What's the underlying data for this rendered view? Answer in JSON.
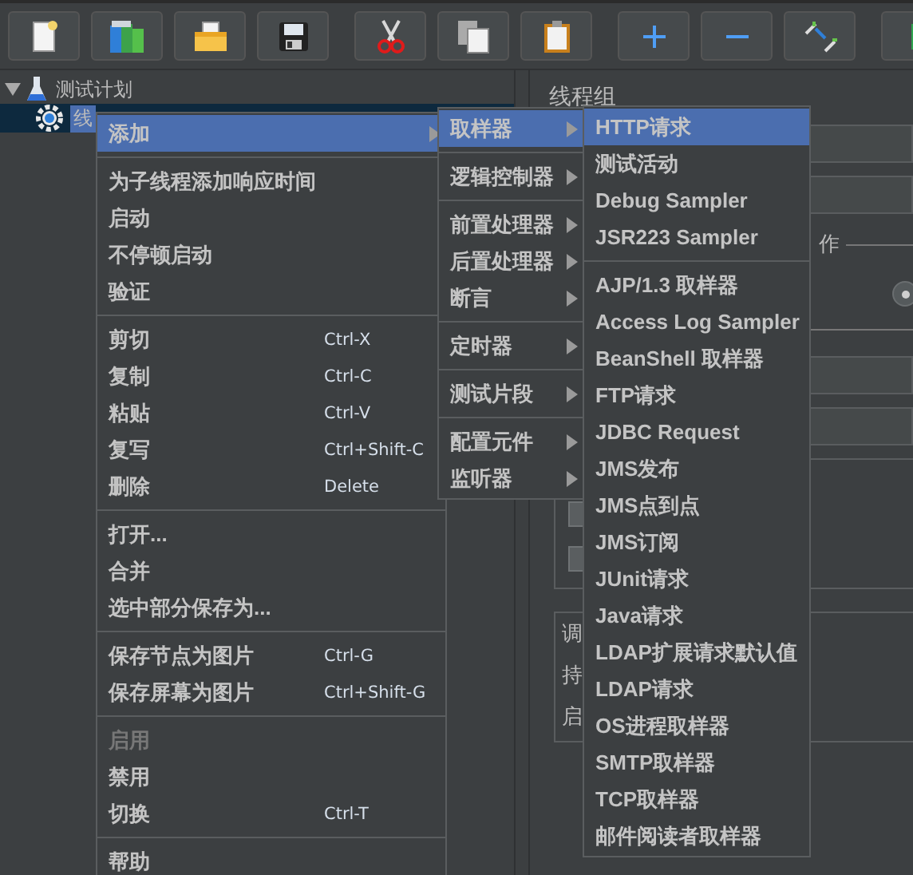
{
  "toolbar": [
    {
      "kind": "new"
    },
    {
      "kind": "templates"
    },
    {
      "kind": "open"
    },
    {
      "kind": "save"
    },
    {
      "kind": "cut"
    },
    {
      "kind": "copy"
    },
    {
      "kind": "paste"
    },
    {
      "kind": "expand"
    },
    {
      "kind": "collapse"
    },
    {
      "kind": "toggle"
    },
    {
      "kind": "start"
    }
  ],
  "tree": [
    {
      "label": "测试计划",
      "expanded": true,
      "selected": false,
      "children": [
        {
          "label": "线",
          "selected": true
        }
      ]
    }
  ],
  "panel": {
    "title": "线程组",
    "legend_1": "作",
    "radio": {
      "selected": true
    },
    "checkboxes": [
      {
        "checked": false
      },
      {
        "checked": false
      }
    ],
    "legend_2": "调",
    "row_1": "持",
    "row_2": "启"
  },
  "context_menu": {
    "groups": [
      [
        {
          "label": "添加",
          "submenu": true,
          "selected": true,
          "disabled": false
        }
      ],
      [
        {
          "label": "为子线程添加响应时间",
          "submenu": false,
          "selected": false,
          "disabled": false
        },
        {
          "label": "启动",
          "submenu": false,
          "selected": false,
          "disabled": false
        },
        {
          "label": "不停顿启动",
          "submenu": false,
          "selected": false,
          "disabled": false
        },
        {
          "label": "验证",
          "submenu": false,
          "selected": false,
          "disabled": false
        }
      ],
      [
        {
          "label": "剪切",
          "shortcut": "Ctrl-X",
          "submenu": false,
          "selected": false,
          "disabled": false
        },
        {
          "label": "复制",
          "shortcut": "Ctrl-C",
          "submenu": false,
          "selected": false,
          "disabled": false
        },
        {
          "label": "粘贴",
          "shortcut": "Ctrl-V",
          "submenu": false,
          "selected": false,
          "disabled": false
        },
        {
          "label": "复写",
          "shortcut": "Ctrl+Shift-C",
          "submenu": false,
          "selected": false,
          "disabled": false
        },
        {
          "label": "删除",
          "shortcut": "Delete",
          "submenu": false,
          "selected": false,
          "disabled": false
        }
      ],
      [
        {
          "label": "打开...",
          "submenu": false,
          "selected": false,
          "disabled": false
        },
        {
          "label": "合并",
          "submenu": false,
          "selected": false,
          "disabled": false
        },
        {
          "label": "选中部分保存为...",
          "submenu": false,
          "selected": false,
          "disabled": false
        }
      ],
      [
        {
          "label": "保存节点为图片",
          "shortcut": "Ctrl-G",
          "submenu": false,
          "selected": false,
          "disabled": false
        },
        {
          "label": "保存屏幕为图片",
          "shortcut": "Ctrl+Shift-G",
          "submenu": false,
          "selected": false,
          "disabled": false
        }
      ],
      [
        {
          "label": "启用",
          "submenu": false,
          "selected": false,
          "disabled": true
        },
        {
          "label": "禁用",
          "submenu": false,
          "selected": false,
          "disabled": false
        },
        {
          "label": "切换",
          "shortcut": "Ctrl-T",
          "submenu": false,
          "selected": false,
          "disabled": false
        }
      ],
      [
        {
          "label": "帮助",
          "submenu": false,
          "selected": false,
          "disabled": false
        }
      ]
    ]
  },
  "add_submenu": {
    "groups": [
      [
        {
          "label": "取样器",
          "submenu": true,
          "selected": true
        }
      ],
      [
        {
          "label": "逻辑控制器",
          "submenu": true,
          "selected": false
        }
      ],
      [
        {
          "label": "前置处理器",
          "submenu": true,
          "selected": false
        },
        {
          "label": "后置处理器",
          "submenu": true,
          "selected": false
        },
        {
          "label": "断言",
          "submenu": true,
          "selected": false
        }
      ],
      [
        {
          "label": "定时器",
          "submenu": true,
          "selected": false
        }
      ],
      [
        {
          "label": "测试片段",
          "submenu": true,
          "selected": false
        }
      ],
      [
        {
          "label": "配置元件",
          "submenu": true,
          "selected": false
        },
        {
          "label": "监听器",
          "submenu": true,
          "selected": false
        }
      ]
    ]
  },
  "sampler_submenu": {
    "groups": [
      [
        {
          "label": "HTTP请求",
          "selected": true
        },
        {
          "label": "测试活动",
          "selected": false
        },
        {
          "label": "Debug Sampler",
          "selected": false
        },
        {
          "label": "JSR223 Sampler",
          "selected": false
        }
      ],
      [
        {
          "label": "AJP/1.3 取样器",
          "selected": false
        },
        {
          "label": "Access Log Sampler",
          "selected": false
        },
        {
          "label": "BeanShell 取样器",
          "selected": false
        },
        {
          "label": "FTP请求",
          "selected": false
        },
        {
          "label": "JDBC Request",
          "selected": false
        },
        {
          "label": "JMS发布",
          "selected": false
        },
        {
          "label": "JMS点到点",
          "selected": false
        },
        {
          "label": "JMS订阅",
          "selected": false
        },
        {
          "label": "JUnit请求",
          "selected": false
        },
        {
          "label": "Java请求",
          "selected": false
        },
        {
          "label": "LDAP扩展请求默认值",
          "selected": false
        },
        {
          "label": "LDAP请求",
          "selected": false
        },
        {
          "label": "OS进程取样器",
          "selected": false
        },
        {
          "label": "SMTP取样器",
          "selected": false
        },
        {
          "label": "TCP取样器",
          "selected": false
        },
        {
          "label": "邮件阅读者取样器",
          "selected": false
        }
      ]
    ]
  }
}
